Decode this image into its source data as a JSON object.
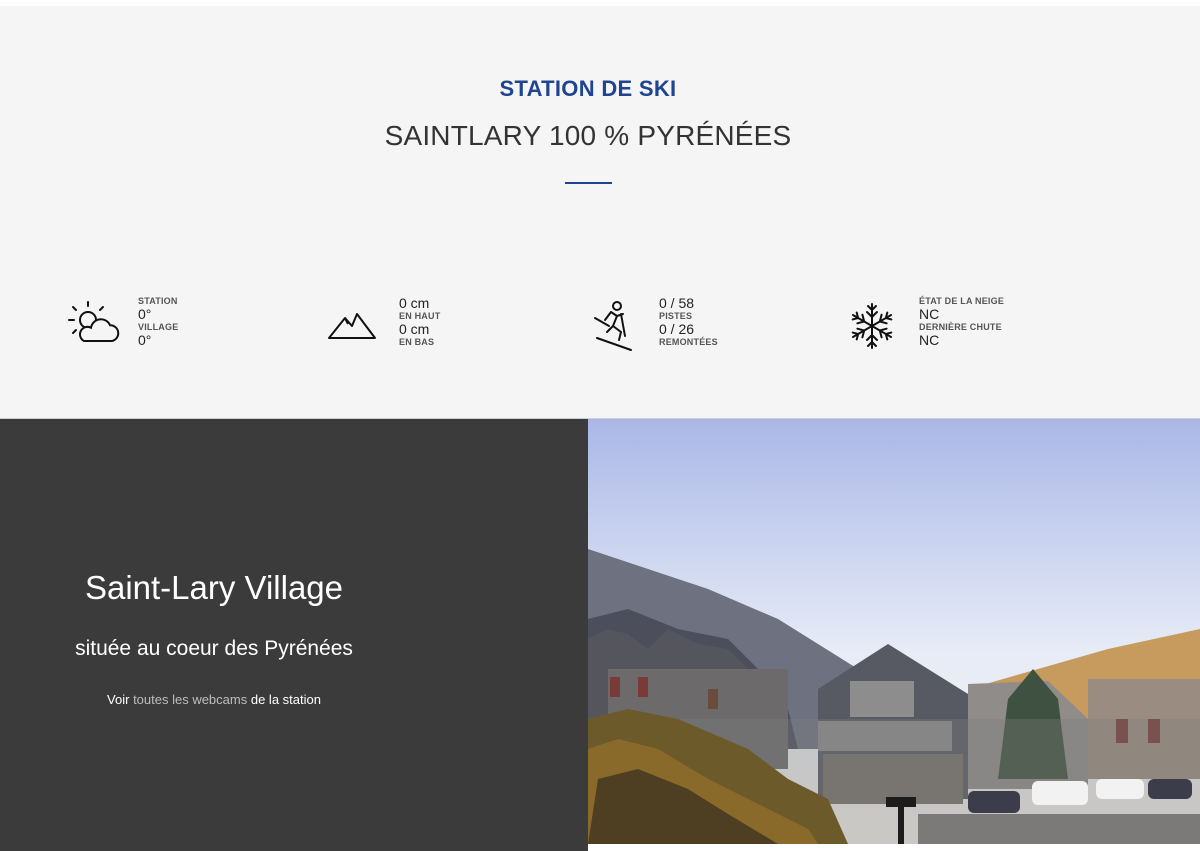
{
  "header": {
    "kicker": "STATION DE SKI",
    "title": "SAINTLARY 100 % PYRÉNÉES"
  },
  "stats": {
    "weather": {
      "label_station": "STATION",
      "value_station": "0°",
      "label_village": "VILLAGE",
      "value_village": "0°",
      "icon": "sun-cloud-icon"
    },
    "snow_depth": {
      "value_top": "0 cm",
      "label_top": "EN HAUT",
      "value_bottom": "0 cm",
      "label_bottom": "EN BAS",
      "icon": "mountain-icon"
    },
    "slopes": {
      "value_pistes": "0 / 58",
      "label_pistes": "PISTES",
      "value_lifts": "0 / 26",
      "label_lifts": "REMONTÉES",
      "icon": "skier-icon"
    },
    "snow_state": {
      "label_state": "ÉTAT DE LA NEIGE",
      "value_state": "NC",
      "label_last": "DERNIÈRE CHUTE",
      "value_last": "NC",
      "icon": "snowflake-icon"
    }
  },
  "village": {
    "title": "Saint-Lary Village",
    "subtitle": "située au coeur des Pyrénées",
    "link_prefix": "Voir",
    "link_text": "toutes les webcams",
    "link_suffix": "de la station"
  },
  "colors": {
    "accent": "#1f4490",
    "dark_panel": "#3b3b3b",
    "band": "#f5f5f5"
  }
}
